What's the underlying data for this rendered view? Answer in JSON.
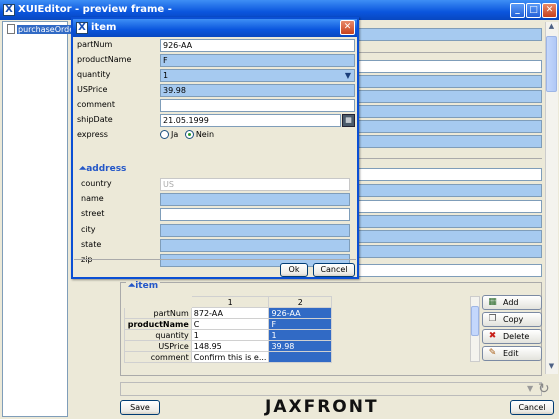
{
  "main_window": {
    "title": "XUIEditor - preview frame -",
    "minimize": "_",
    "maximize": "□",
    "close": "✕"
  },
  "tree": {
    "root_label": "purchaseOrder"
  },
  "items_panel": {
    "title": "item",
    "columns": [
      "1",
      "2"
    ],
    "rows": [
      {
        "label": "partNum",
        "values": [
          "872-AA",
          "926-AA"
        ]
      },
      {
        "label": "productName",
        "values": [
          "C",
          "F"
        ]
      },
      {
        "label": "quantity",
        "values": [
          "1",
          "1"
        ]
      },
      {
        "label": "USPrice",
        "values": [
          "148.95",
          "39.98"
        ]
      },
      {
        "label": "comment",
        "values": [
          "Confirm this is e...",
          ""
        ]
      }
    ],
    "buttons": {
      "add": "Add",
      "copy": "Copy",
      "delete": "Delete",
      "edit": "Edit"
    }
  },
  "footer": {
    "save": "Save",
    "logo": "JAXFRONT",
    "cancel": "Cancel"
  },
  "dialog": {
    "title": "item",
    "close": "✕",
    "fields": {
      "partNum": {
        "label": "partNum",
        "value": "926-AA"
      },
      "productName": {
        "label": "productName",
        "value": "F"
      },
      "quantity": {
        "label": "quantity",
        "value": "1"
      },
      "USPrice": {
        "label": "USPrice",
        "value": "39.98"
      },
      "comment": {
        "label": "comment",
        "value": ""
      },
      "shipDate": {
        "label": "shipDate",
        "value": "21.05.1999"
      },
      "express": {
        "label": "express",
        "option_ja": "Ja",
        "option_nein": "Nein",
        "selected": "Nein"
      }
    },
    "address": {
      "title": "address",
      "country": {
        "label": "country",
        "placeholder": "US"
      },
      "name": {
        "label": "name",
        "value": ""
      },
      "street": {
        "label": "street",
        "value": ""
      },
      "city": {
        "label": "city",
        "value": ""
      },
      "state": {
        "label": "state",
        "value": ""
      },
      "zip": {
        "label": "zip",
        "value": ""
      }
    },
    "ok": "Ok",
    "cancel": "Cancel"
  },
  "colors": {
    "title_blue": "#0a55dd",
    "field_blue": "#a6caf0",
    "selection_blue": "#316ac5",
    "section_title": "#2457c8"
  }
}
